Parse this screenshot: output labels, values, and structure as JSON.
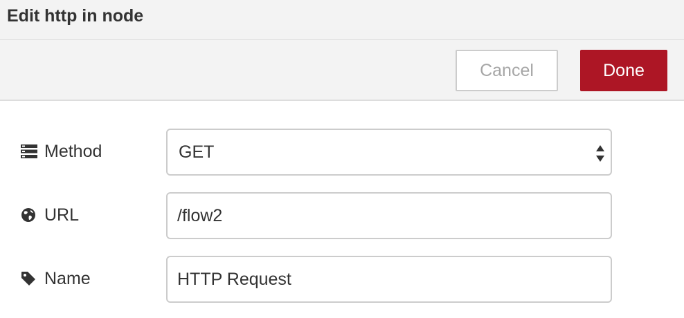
{
  "dialog": {
    "title": "Edit http in node"
  },
  "toolbar": {
    "cancel_label": "Cancel",
    "done_label": "Done"
  },
  "form": {
    "method": {
      "label": "Method",
      "icon": "tasks-icon",
      "value": "GET"
    },
    "url": {
      "label": "URL",
      "icon": "globe-icon",
      "value": "/flow2"
    },
    "name": {
      "label": "Name",
      "icon": "tag-icon",
      "value": "HTTP Request"
    }
  },
  "colors": {
    "accent": "#ad1625",
    "header_bg": "#f3f3f3",
    "border": "#cccccc"
  }
}
